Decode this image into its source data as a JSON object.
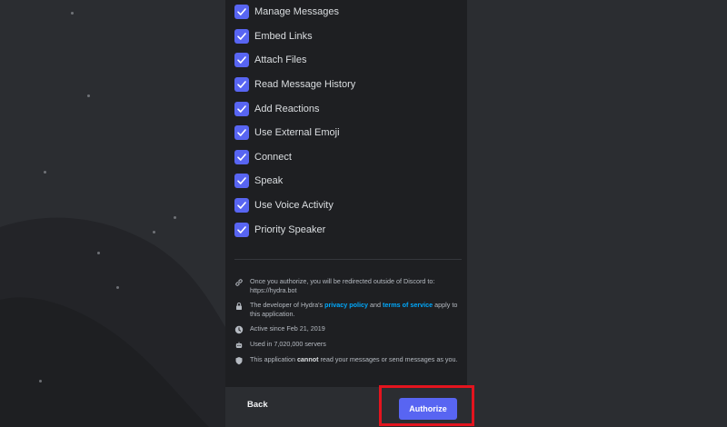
{
  "permissions": [
    {
      "label": "Manage Messages",
      "checked": true
    },
    {
      "label": "Embed Links",
      "checked": true
    },
    {
      "label": "Attach Files",
      "checked": true
    },
    {
      "label": "Read Message History",
      "checked": true
    },
    {
      "label": "Add Reactions",
      "checked": true
    },
    {
      "label": "Use External Emoji",
      "checked": true
    },
    {
      "label": "Connect",
      "checked": true
    },
    {
      "label": "Speak",
      "checked": true
    },
    {
      "label": "Use Voice Activity",
      "checked": true
    },
    {
      "label": "Priority Speaker",
      "checked": true
    }
  ],
  "info": {
    "redirect": "Once you authorize, you will be redirected outside of Discord to: https://hydra.bot",
    "policy_prefix": "The developer of Hydra's ",
    "privacy_policy": "privacy policy",
    "policy_and": " and ",
    "terms_of_service": "terms of service",
    "policy_suffix": " apply to this application.",
    "active_since": "Active since Feb 21, 2019",
    "used_in": "Used in 7,020,000 servers",
    "cannot_prefix": "This application ",
    "cannot_word": "cannot",
    "cannot_suffix": " read your messages or send messages as you."
  },
  "footer": {
    "back_label": "Back",
    "authorize_label": "Authorize"
  },
  "icons": {
    "checkbox": "check-icon",
    "link": "link-icon",
    "lock": "lock-icon",
    "clock": "clock-icon",
    "robot": "robot-icon",
    "shield": "shield-icon"
  },
  "colors": {
    "accent": "#5865f2",
    "highlight": "#e3141e",
    "link": "#00a8fc"
  }
}
